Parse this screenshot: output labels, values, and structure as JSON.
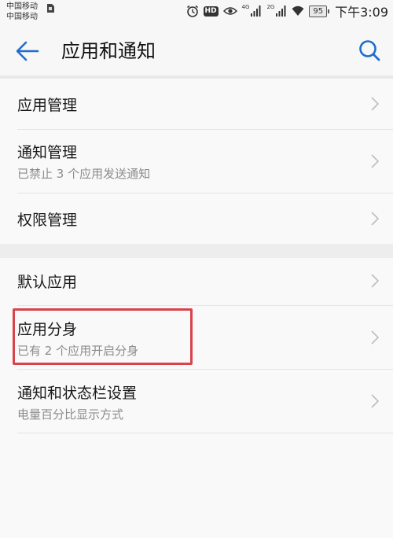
{
  "status_bar": {
    "carrier_1": "中国移动",
    "carrier_2": "中国移动",
    "hd": "HD",
    "net_1": "4G",
    "net_2": "2G",
    "battery": "95",
    "time": "下午3:09"
  },
  "header": {
    "title": "应用和通知"
  },
  "group_1": [
    {
      "title": "应用管理",
      "subtitle": ""
    },
    {
      "title": "通知管理",
      "subtitle": "已禁止 3 个应用发送通知"
    },
    {
      "title": "权限管理",
      "subtitle": ""
    }
  ],
  "group_2": [
    {
      "title": "默认应用",
      "subtitle": ""
    },
    {
      "title": "应用分身",
      "subtitle": "已有 2 个应用开启分身"
    },
    {
      "title": "通知和状态栏设置",
      "subtitle": "电量百分比显示方式"
    }
  ],
  "colors": {
    "accent": "#1e6ed0",
    "highlight": "#d9434a",
    "subtitle": "#8c8c8c"
  },
  "icons": {
    "back": "arrow-left-icon",
    "search": "search-icon",
    "chevron": "chevron-right-icon"
  }
}
